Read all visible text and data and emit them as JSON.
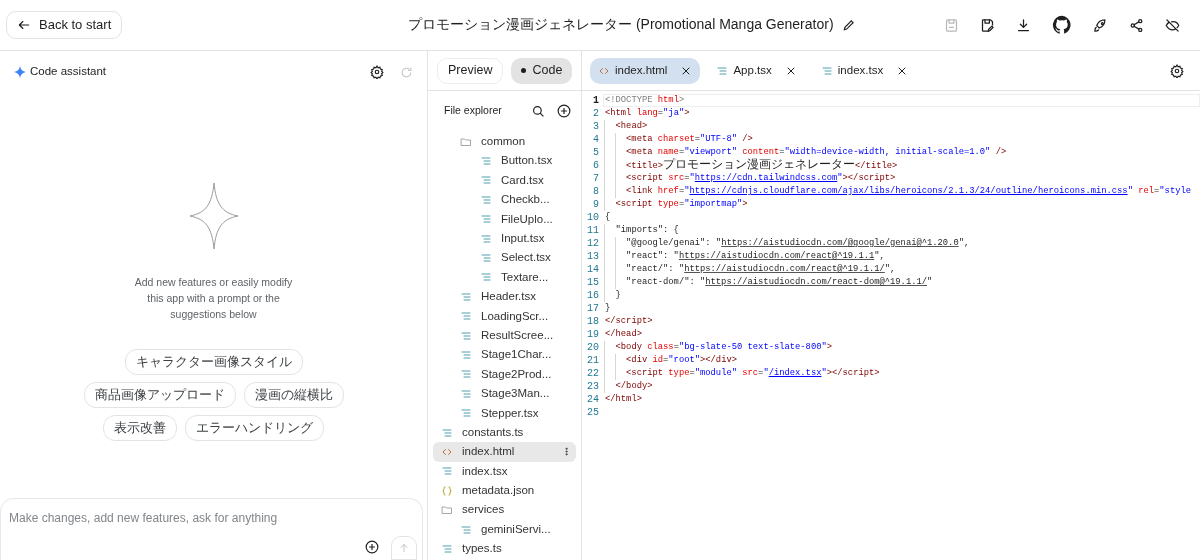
{
  "header": {
    "back_button": "Back to start",
    "title": "プロモーション漫画ジェネレーター (Promotional Manga Generator)",
    "actions": [
      {
        "kind": "save",
        "disabled": true
      },
      {
        "kind": "save-edit",
        "disabled": false
      },
      {
        "kind": "download",
        "disabled": false
      },
      {
        "kind": "github",
        "disabled": false
      },
      {
        "kind": "rocket",
        "disabled": false
      },
      {
        "kind": "share",
        "disabled": false
      },
      {
        "kind": "hide",
        "disabled": false
      }
    ]
  },
  "assistant": {
    "title": "Code assistant",
    "refresh_disabled": true,
    "intro": "Add new features or easily modify this app with a prompt or the suggestions below",
    "suggestions": [
      "キャラクター画像スタイル",
      "商品画像アップロード",
      "漫画の縦横比",
      "表示改善",
      "エラーハンドリング"
    ],
    "prompt": {
      "placeholder": "Make changes, add new features, ask for anything",
      "send_disabled": true
    }
  },
  "view_toggle": [
    {
      "label": "Preview",
      "selected": false
    },
    {
      "label": "Code",
      "selected": true
    }
  ],
  "tabs": [
    {
      "label": "index.html",
      "kind": "html",
      "selected": true
    },
    {
      "label": "App.tsx",
      "kind": "file",
      "selected": false
    },
    {
      "label": "index.tsx",
      "kind": "file",
      "selected": false
    }
  ],
  "explorer": {
    "title": "File explorer",
    "items": [
      {
        "children": [
          {
            "name": "common",
            "kind": "folder",
            "selected": false,
            "children": [
              {
                "name": "Button.tsx",
                "kind": "file",
                "selected": false
              },
              {
                "name": "Card.tsx",
                "kind": "file",
                "selected": false
              },
              {
                "name": "Checkb...",
                "kind": "file",
                "selected": false
              },
              {
                "name": "FileUplo...",
                "kind": "file",
                "selected": false
              },
              {
                "name": "Input.tsx",
                "kind": "file",
                "selected": false
              },
              {
                "name": "Select.tsx",
                "kind": "file",
                "selected": false
              },
              {
                "name": "Textare...",
                "kind": "file",
                "selected": false
              }
            ]
          },
          {
            "name": "Header.tsx",
            "kind": "file",
            "selected": false
          },
          {
            "name": "LoadingScr...",
            "kind": "file",
            "selected": false
          },
          {
            "name": "ResultScree...",
            "kind": "file",
            "selected": false
          },
          {
            "name": "Stage1Char...",
            "kind": "file",
            "selected": false
          },
          {
            "name": "Stage2Prod...",
            "kind": "file",
            "selected": false
          },
          {
            "name": "Stage3Man...",
            "kind": "file",
            "selected": false
          },
          {
            "name": "Stepper.tsx",
            "kind": "file",
            "selected": false
          }
        ]
      },
      {
        "name": "constants.ts",
        "kind": "file",
        "selected": false
      },
      {
        "name": "index.html",
        "kind": "html",
        "selected": true
      },
      {
        "name": "index.tsx",
        "kind": "file",
        "selected": false
      },
      {
        "name": "metadata.json",
        "kind": "json",
        "selected": false
      },
      {
        "name": "services",
        "kind": "folder",
        "selected": false,
        "children": [
          {
            "name": "geminiServi...",
            "kind": "file",
            "selected": false
          }
        ]
      },
      {
        "name": "types.ts",
        "kind": "file",
        "selected": false
      }
    ]
  },
  "code": {
    "lines": [
      {
        "number": "1",
        "active": true,
        "segs": [
          {
            "kind": "gray",
            "text": "<!DOCTYPE "
          },
          {
            "kind": "attr",
            "text": "html"
          },
          {
            "kind": "gray",
            "text": ">"
          }
        ]
      },
      {
        "number": "2",
        "active": false,
        "segs": [
          {
            "kind": "tag",
            "text": "<html "
          },
          {
            "kind": "attr",
            "text": "lang"
          },
          {
            "kind": "plain",
            "text": "="
          },
          {
            "kind": "string",
            "text": "\"ja\""
          },
          {
            "kind": "tag",
            "text": ">"
          }
        ]
      },
      {
        "number": "3",
        "active": false,
        "segs": [
          {
            "kind": "tag",
            "text": "  <head>"
          }
        ]
      },
      {
        "number": "4",
        "active": false,
        "segs": [
          {
            "kind": "tag",
            "text": "    <meta "
          },
          {
            "kind": "attr",
            "text": "charset"
          },
          {
            "kind": "plain",
            "text": "="
          },
          {
            "kind": "string",
            "text": "\"UTF-8\""
          },
          {
            "kind": "tag",
            "text": " />"
          }
        ]
      },
      {
        "number": "5",
        "active": false,
        "segs": [
          {
            "kind": "tag",
            "text": "    <meta "
          },
          {
            "kind": "attr",
            "text": "name"
          },
          {
            "kind": "plain",
            "text": "="
          },
          {
            "kind": "string",
            "text": "\"viewport\""
          },
          {
            "kind": "attr",
            "text": " content"
          },
          {
            "kind": "plain",
            "text": "="
          },
          {
            "kind": "string",
            "text": "\"width=device-width, initial-scale=1.0\""
          },
          {
            "kind": "tag",
            "text": " />"
          }
        ]
      },
      {
        "number": "6",
        "active": false,
        "segs": [
          {
            "kind": "tag",
            "text": "    <title>"
          },
          {
            "kind": "cjk",
            "text": "プロモーション漫画ジェネレーター"
          },
          {
            "kind": "tag",
            "text": "</title>"
          }
        ]
      },
      {
        "number": "7",
        "active": false,
        "segs": [
          {
            "kind": "tag",
            "text": "    <script "
          },
          {
            "kind": "attr",
            "text": "src"
          },
          {
            "kind": "plain",
            "text": "="
          },
          {
            "kind": "string",
            "text": "\""
          },
          {
            "kind": "link",
            "text": "https://cdn.tailwindcss.com"
          },
          {
            "kind": "string",
            "text": "\""
          },
          {
            "kind": "tag",
            "text": "></script>"
          }
        ]
      },
      {
        "number": "8",
        "active": false,
        "segs": [
          {
            "kind": "tag",
            "text": "    <link "
          },
          {
            "kind": "attr",
            "text": "href"
          },
          {
            "kind": "plain",
            "text": "="
          },
          {
            "kind": "string",
            "text": "\""
          },
          {
            "kind": "link",
            "text": "https://cdnjs.cloudflare.com/ajax/libs/heroicons/2.1.3/24/outline/heroicons.min.css"
          },
          {
            "kind": "string",
            "text": "\""
          },
          {
            "kind": "attr",
            "text": " rel"
          },
          {
            "kind": "plain",
            "text": "="
          },
          {
            "kind": "string",
            "text": "\"style"
          }
        ]
      },
      {
        "number": "9",
        "active": false,
        "segs": [
          {
            "kind": "tag",
            "text": "  <script "
          },
          {
            "kind": "attr",
            "text": "type"
          },
          {
            "kind": "plain",
            "text": "="
          },
          {
            "kind": "string",
            "text": "\"importmap\""
          },
          {
            "kind": "tag",
            "text": ">"
          }
        ]
      },
      {
        "number": "10",
        "active": false,
        "segs": [
          {
            "kind": "plain",
            "text": "{"
          }
        ]
      },
      {
        "number": "11",
        "active": false,
        "segs": [
          {
            "kind": "plain",
            "text": "  \"imports\": {"
          }
        ]
      },
      {
        "number": "12",
        "active": false,
        "segs": [
          {
            "kind": "plain",
            "text": "    \"@google/genai\": \""
          },
          {
            "kind": "url",
            "text": "https://aistudiocdn.com/@google/genai@^1.20.0"
          },
          {
            "kind": "plain",
            "text": "\","
          }
        ]
      },
      {
        "number": "13",
        "active": false,
        "segs": [
          {
            "kind": "plain",
            "text": "    \"react\": \""
          },
          {
            "kind": "url",
            "text": "https://aistudiocdn.com/react@^19.1.1"
          },
          {
            "kind": "plain",
            "text": "\","
          }
        ]
      },
      {
        "number": "14",
        "active": false,
        "segs": [
          {
            "kind": "plain",
            "text": "    \"react/\": \""
          },
          {
            "kind": "url",
            "text": "https://aistudiocdn.com/react@^19.1.1/"
          },
          {
            "kind": "plain",
            "text": "\","
          }
        ]
      },
      {
        "number": "15",
        "active": false,
        "segs": [
          {
            "kind": "plain",
            "text": "    \"react-dom/\": \""
          },
          {
            "kind": "url",
            "text": "https://aistudiocdn.com/react-dom@^19.1.1/"
          },
          {
            "kind": "plain",
            "text": "\""
          }
        ]
      },
      {
        "number": "16",
        "active": false,
        "segs": [
          {
            "kind": "plain",
            "text": "  }"
          }
        ]
      },
      {
        "number": "17",
        "active": false,
        "segs": [
          {
            "kind": "plain",
            "text": "}"
          }
        ]
      },
      {
        "number": "18",
        "active": false,
        "segs": [
          {
            "kind": "tag",
            "text": "</script>"
          }
        ]
      },
      {
        "number": "19",
        "active": false,
        "segs": [
          {
            "kind": "tag",
            "text": "</head>"
          }
        ]
      },
      {
        "number": "20",
        "active": false,
        "segs": [
          {
            "kind": "tag",
            "text": "  <body "
          },
          {
            "kind": "attr",
            "text": "class"
          },
          {
            "kind": "plain",
            "text": "="
          },
          {
            "kind": "string",
            "text": "\"bg-slate-50 text-slate-800\""
          },
          {
            "kind": "tag",
            "text": ">"
          }
        ]
      },
      {
        "number": "21",
        "active": false,
        "segs": [
          {
            "kind": "tag",
            "text": "    <div "
          },
          {
            "kind": "attr",
            "text": "id"
          },
          {
            "kind": "plain",
            "text": "="
          },
          {
            "kind": "string",
            "text": "\"root\""
          },
          {
            "kind": "tag",
            "text": "></div>"
          }
        ]
      },
      {
        "number": "22",
        "active": false,
        "segs": [
          {
            "kind": "tag",
            "text": "    <script "
          },
          {
            "kind": "attr",
            "text": "type"
          },
          {
            "kind": "plain",
            "text": "="
          },
          {
            "kind": "string",
            "text": "\"module\""
          },
          {
            "kind": "attr",
            "text": " src"
          },
          {
            "kind": "plain",
            "text": "="
          },
          {
            "kind": "string",
            "text": "\""
          },
          {
            "kind": "link",
            "text": "/index.tsx"
          },
          {
            "kind": "string",
            "text": "\""
          },
          {
            "kind": "tag",
            "text": "></script>"
          }
        ]
      },
      {
        "number": "23",
        "active": false,
        "segs": [
          {
            "kind": "tag",
            "text": "  </body>"
          }
        ]
      },
      {
        "number": "24",
        "active": false,
        "segs": [
          {
            "kind": "tag",
            "text": "</html>"
          }
        ]
      },
      {
        "number": "25",
        "active": false
      }
    ]
  }
}
